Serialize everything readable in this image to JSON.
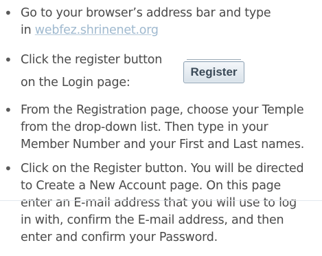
{
  "instructions": [
    {
      "lines": [
        "Go to your browser’s address bar and type"
      ],
      "last_line_prefix": "in ",
      "link": "webfez.shrinenet.org"
    },
    {
      "lines": [
        "Click the register button",
        "on the Login page:"
      ],
      "button_label": "Register"
    },
    {
      "lines": [
        "From the Registration page, choose your Temple",
        "from the drop-down list. Then type in your",
        "Member Number and your First and Last names."
      ]
    },
    {
      "lines": [
        "Click on the Register button. You will be directed",
        "to Create a New Account page. On this page",
        "enter an E-mail address that you will use to log",
        "in with, confirm the E-mail address, and then",
        "enter and confirm your Password."
      ]
    }
  ],
  "bullet_glyph": "•",
  "colors": {
    "text": "#4a4a4a",
    "link": "#9fb9cf",
    "button_text": "#3b4a58"
  }
}
